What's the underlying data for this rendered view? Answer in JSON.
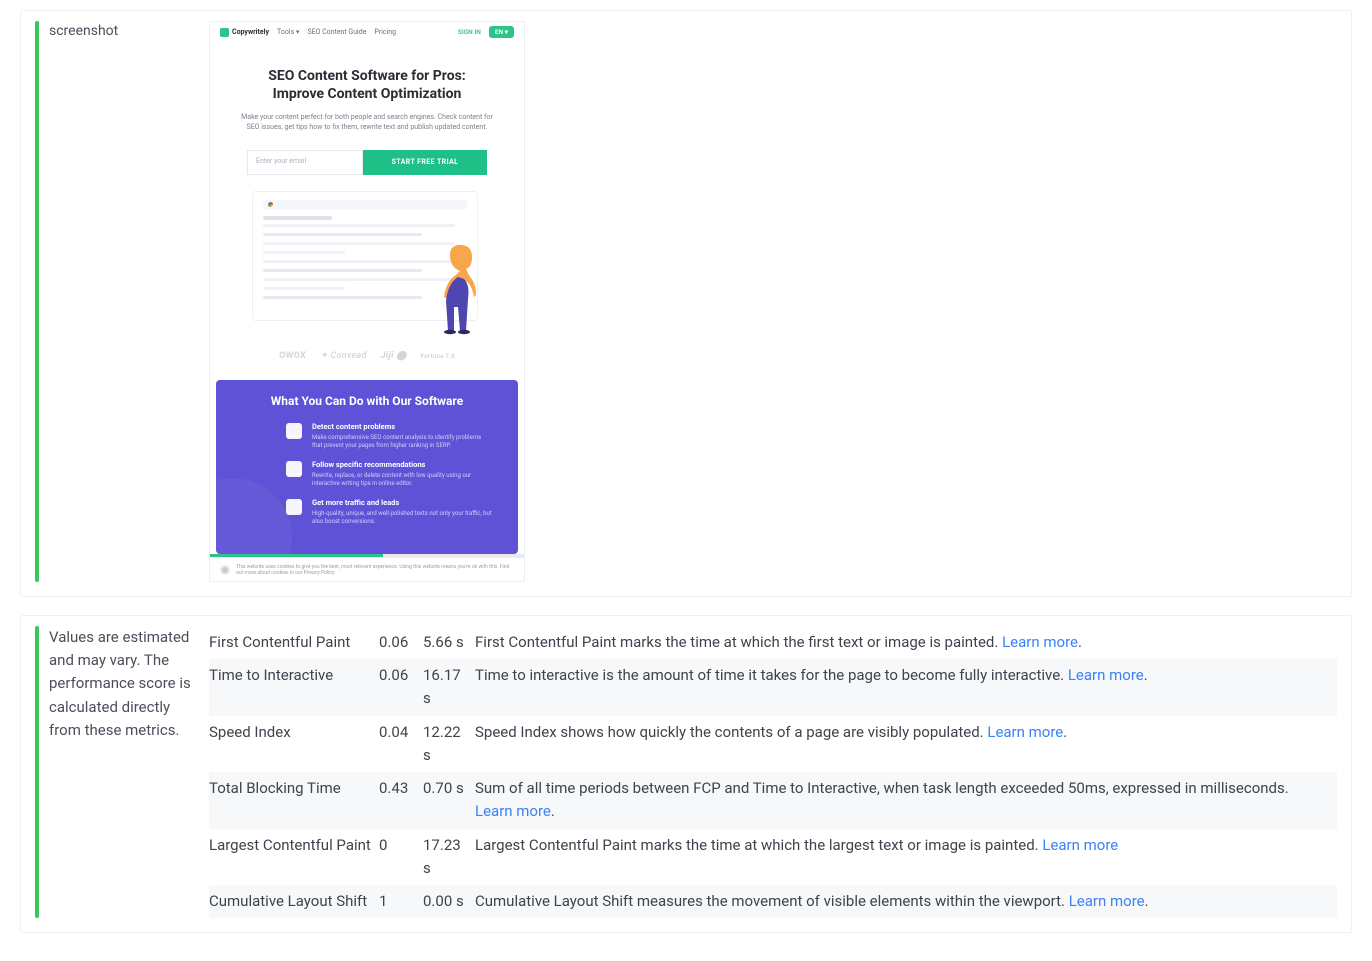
{
  "screenshot_block": {
    "label": "screenshot"
  },
  "mini_page": {
    "nav": {
      "brand": "Copywritely",
      "items": [
        "Tools ▾",
        "SEO Content Guide",
        "Pricing"
      ],
      "signin": "SIGN IN",
      "lang": "EN ▾"
    },
    "hero": {
      "title_line1": "SEO Content Software for Pros:",
      "title_line2": "Improve Content Optimization",
      "subtitle": "Make your content perfect for both people and search engines. Check content for SEO issues, get tips how to fix them, rewrite text and publish updated content."
    },
    "cta": {
      "email_placeholder": "Enter your email",
      "button": "START FREE TRIAL"
    },
    "brands": [
      "OWOX",
      "✦ Convead",
      "Jiji ⬤",
      "Fortuna 7.0"
    ],
    "purple": {
      "heading": "What You Can Do with Our Software",
      "features": [
        {
          "title": "Detect content problems",
          "desc": "Make comprehensive SEO content analysis to identify problems that prevent your pages from higher ranking in SERP."
        },
        {
          "title": "Follow specific recommendations",
          "desc": "Rewrite, replace, or delete content with low quality using our interactive writing tips in online editor."
        },
        {
          "title": "Get more traffic and leads",
          "desc": "High-quality, unique, and well-polished texts not only your traffic, but also boost conversions."
        }
      ]
    },
    "cookie": "This website uses cookies to give you the best, most relevant experience. Using this website means you're ok with this. Find out more about cookies in our Privacy Policy."
  },
  "metrics_block": {
    "desc": "Values are estimated and may vary. The performance score is calculated directly from these metrics.",
    "learn_more": "Learn more",
    "rows": [
      {
        "name": "First Contentful Paint",
        "score": "0.06",
        "time": "5.66 s",
        "desc": "First Contentful Paint marks the time at which the first text or image is painted."
      },
      {
        "name": "Time to Interactive",
        "score": "0.06",
        "time": "16.17 s",
        "desc": "Time to interactive is the amount of time it takes for the page to become fully interactive."
      },
      {
        "name": "Speed Index",
        "score": "0.04",
        "time": "12.22 s",
        "desc": "Speed Index shows how quickly the contents of a page are visibly populated."
      },
      {
        "name": "Total Blocking Time",
        "score": "0.43",
        "time": "0.70 s",
        "desc": "Sum of all time periods between FCP and Time to Interactive, when task length exceeded 50ms, expressed in milliseconds."
      },
      {
        "name": "Largest Contentful Paint",
        "score": "0",
        "time": "17.23 s",
        "desc": "Largest Contentful Paint marks the time at which the largest text or image is painted."
      },
      {
        "name": "Cumulative Layout Shift",
        "score": "1",
        "time": "0.00 s",
        "desc": "Cumulative Layout Shift measures the movement of visible elements within the viewport."
      }
    ]
  }
}
